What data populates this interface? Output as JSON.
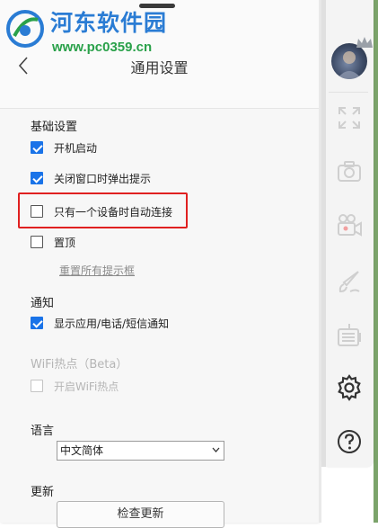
{
  "watermark": {
    "title": "河东软件园",
    "url": "www.pc0359.cn"
  },
  "header": {
    "title": "通用设置"
  },
  "sections": {
    "basic": {
      "title": "基础设置",
      "options": [
        {
          "label": "开机启动",
          "checked": true
        },
        {
          "label": "关闭窗口时弹出提示",
          "checked": true
        },
        {
          "label": "只有一个设备时自动连接",
          "checked": false
        },
        {
          "label": "置顶",
          "checked": false
        }
      ],
      "reset_link": "重置所有提示框"
    },
    "notify": {
      "title": "通知",
      "options": [
        {
          "label": "显示应用/电话/短信通知",
          "checked": true
        }
      ]
    },
    "wifi": {
      "title": "WiFi热点（Beta）",
      "options": [
        {
          "label": "开启WiFi热点",
          "checked": false,
          "disabled": true
        }
      ]
    },
    "language": {
      "title": "语言",
      "selected": "中文简体"
    },
    "update": {
      "title": "更新",
      "button": "检查更新"
    }
  },
  "toolbar": {
    "icons": [
      "avatar",
      "fullscreen-icon",
      "camera-icon",
      "video-camera-icon",
      "brush-icon",
      "keyboard-icon",
      "gear-icon",
      "help-icon"
    ]
  },
  "colors": {
    "accent": "#1a73e8",
    "highlight": "#e02020",
    "watermark_blue": "#2a7cd4",
    "watermark_green": "#2aa14a"
  }
}
